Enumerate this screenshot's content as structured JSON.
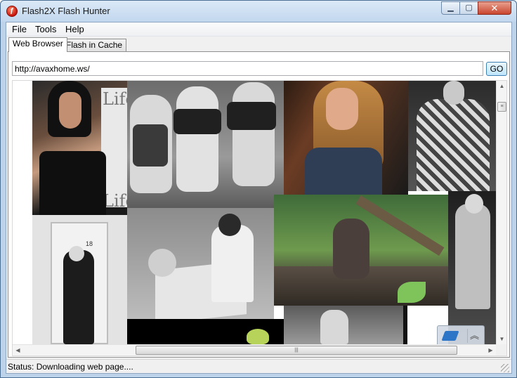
{
  "window": {
    "title": "Flash2X Flash Hunter"
  },
  "window_controls": {
    "minimize": "▁",
    "maximize": "▢",
    "close": "✕"
  },
  "menu": {
    "items": [
      "File",
      "Tools",
      "Help"
    ]
  },
  "tabs": [
    {
      "label": "Web Browser",
      "active": true
    },
    {
      "label": "Flash in Cache",
      "active": false
    }
  ],
  "browser": {
    "url": "http://avaxhome.ws/",
    "go_label": "GO",
    "photo_texts": {
      "sign_top": "Life",
      "sign_bottom": "Life",
      "door_number": "18"
    }
  },
  "scrollbars": {
    "up": "▲",
    "down": "▼",
    "left": "◀",
    "right": "▶",
    "grip": "≡",
    "hgrip": "|||"
  },
  "status": {
    "text": "Status: Downloading web page...."
  },
  "colors": {
    "accent": "#3c7fb1",
    "title_bar": "#c2d7ee",
    "close_button": "#c9462e"
  },
  "icons": {
    "app": "flash2x-logo-icon",
    "eraser": "eraser-icon",
    "collapse": "double-chevron-up-icon"
  }
}
